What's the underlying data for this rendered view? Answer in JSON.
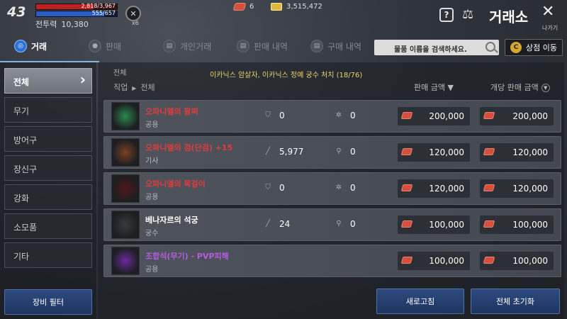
{
  "player": {
    "level": "43",
    "hp_text": "2,818/3,967",
    "hp_ratio": 0.71,
    "mp_text": "555/657",
    "mp_ratio": 0.84,
    "power_label": "전투력",
    "power_value": "10,380",
    "buff_count": "x6"
  },
  "currency": {
    "gems": "6",
    "gold": "3,515,472"
  },
  "header": {
    "title": "거래소",
    "help_icon": "?",
    "close_label": "나가기"
  },
  "tabs": [
    {
      "label": "거래",
      "icon": "trade-icon",
      "active": true
    },
    {
      "label": "판매",
      "icon": "sell-icon",
      "active": false
    },
    {
      "label": "개인거래",
      "icon": "private-trade-icon",
      "active": false
    },
    {
      "label": "판매 내역",
      "icon": "sell-history-icon",
      "active": false
    },
    {
      "label": "구매 내역",
      "icon": "buy-history-icon",
      "active": false
    }
  ],
  "search": {
    "placeholder": "물품 이름을 검색하세요."
  },
  "shop_button": {
    "label": "상점 이동",
    "icon_text": "C"
  },
  "sidebar": {
    "items": [
      {
        "label": "전체",
        "active": true
      },
      {
        "label": "무기"
      },
      {
        "label": "방어구"
      },
      {
        "label": "장신구"
      },
      {
        "label": "강화"
      },
      {
        "label": "소모품"
      },
      {
        "label": "기타"
      }
    ],
    "filter_label": "장비 필터"
  },
  "list": {
    "breadcrumb": "전체",
    "quest_text": "이카닉스 암살자, 이카닉스 정예 궁수 처치 (18/76)",
    "col_class": "직업",
    "col_class_value": "전체",
    "col_price": "판매 금액",
    "col_unit_price": "개당 판매 금액"
  },
  "items": [
    {
      "name": "오파니엘의 팔찌",
      "color": "#e23c3c",
      "class": "공용",
      "stat1_icon": "shield-icon",
      "stat1": "0",
      "stat2_icon": "gear-icon",
      "stat2": "0",
      "price": "200,000",
      "unit_price": "200,000"
    },
    {
      "name": "오파니엘의 검(단검) +15",
      "color": "#e23c3c",
      "class": "기사",
      "stat1_icon": "sword-icon",
      "stat1": "5,977",
      "stat2_icon": "magnifier-icon",
      "stat2": "0",
      "price": "120,000",
      "unit_price": "120,000"
    },
    {
      "name": "오파니엘의 목걸이",
      "color": "#e23c3c",
      "class": "공용",
      "stat1_icon": "shield-icon",
      "stat1": "0",
      "stat2_icon": "gear-icon",
      "stat2": "0",
      "price": "120,000",
      "unit_price": "120,000"
    },
    {
      "name": "베나자르의 석궁",
      "color": "#ffffff",
      "class": "궁수",
      "stat1_icon": "sword-icon",
      "stat1": "24",
      "stat2_icon": "magnifier-icon",
      "stat2": "0",
      "price": "100,000",
      "unit_price": "100,000"
    },
    {
      "name": "조합석(무기) - PVP피해",
      "color": "#b45de0",
      "class": "공용",
      "stat1_icon": "",
      "stat1": "",
      "stat2_icon": "",
      "stat2": "",
      "price": "100,000",
      "unit_price": "100,000"
    }
  ],
  "buttons": {
    "refresh": "새로고침",
    "reset": "전체 초기화"
  }
}
